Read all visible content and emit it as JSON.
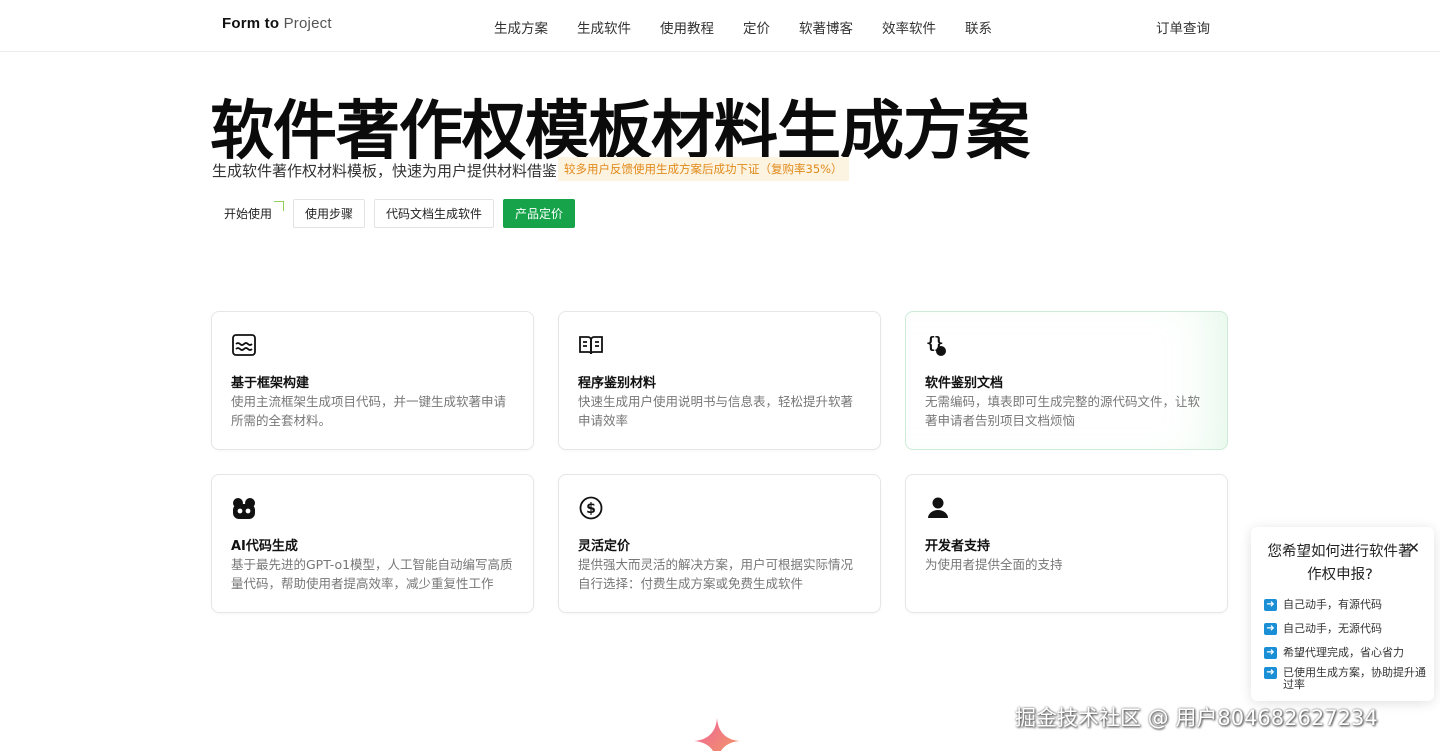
{
  "header": {
    "logo_bold": "Form to",
    "logo_light": " Project",
    "nav": [
      "生成方案",
      "生成软件",
      "使用教程",
      "定价",
      "软著博客",
      "效率软件",
      "联系"
    ],
    "order_query": "订单查询"
  },
  "hero": {
    "title": "软件著作权模板材料生成方案",
    "subtitle": "生成软件著作权材料模板，快速为用户提供材料借鉴",
    "badge": "较多用户反馈使用生成方案后成功下证（复购率35%）",
    "buttons": {
      "start": "开始使用",
      "steps": "使用步骤",
      "codegen": "代码文档生成软件",
      "pricing": "产品定价"
    }
  },
  "features": [
    {
      "icon": "waves-frame-icon",
      "title": "基于框架构建",
      "desc": "使用主流框架生成项目代码，并一键生成软著申请所需的全套材料。"
    },
    {
      "icon": "open-book-icon",
      "title": "程序鉴别材料",
      "desc": "快速生成用户使用说明书与信息表，轻松提升软著申请效率"
    },
    {
      "icon": "braces-dot-icon",
      "title": "软件鉴别文档",
      "desc": "无需编码，填表即可生成完整的源代码文件，让软著申请者告别项目文档烦恼"
    },
    {
      "icon": "github-icon",
      "title": "AI代码生成",
      "desc": "基于最先进的GPT-o1模型，人工智能自动编写高质量代码，帮助使用者提高效率，减少重复性工作"
    },
    {
      "icon": "dollar-circle-icon",
      "title": "灵活定价",
      "desc": "提供强大而灵活的解决方案，用户可根据实际情况自行选择：付费生成方案或免费生成软件"
    },
    {
      "icon": "user-icon",
      "title": "开发者支持",
      "desc": "为使用者提供全面的支持"
    }
  ],
  "popup": {
    "title": "您希望如何进行软件著作权申报?",
    "close": "✕",
    "options": [
      "自己动手，有源代码",
      "自己动手，无源代码",
      "希望代理完成，省心省力",
      "已使用生成方案，协助提升通过率"
    ]
  },
  "watermark": "掘金技术社区 @ 用户804682627234"
}
